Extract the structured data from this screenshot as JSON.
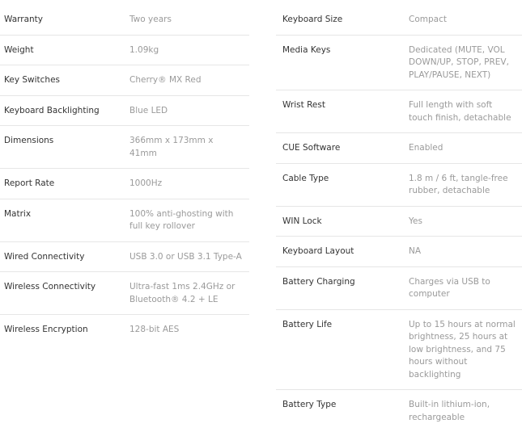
{
  "left_specs": [
    {
      "label": "Warranty",
      "value": "Two years"
    },
    {
      "label": "Weight",
      "value": "1.09kg"
    },
    {
      "label": "Key Switches",
      "value": "Cherry® MX Red"
    },
    {
      "label": "Keyboard Backlighting",
      "value": "Blue LED"
    },
    {
      "label": "Dimensions",
      "value": "366mm x 173mm x 41mm"
    },
    {
      "label": "Report Rate",
      "value": "1000Hz"
    },
    {
      "label": "Matrix",
      "value": "100% anti-ghosting with full key rollover"
    },
    {
      "label": "Wired Connectivity",
      "value": "USB 3.0 or USB 3.1 Type-A"
    },
    {
      "label": "Wireless Connectivity",
      "value": "Ultra-fast 1ms 2.4GHz or Bluetooth® 4.2 + LE"
    },
    {
      "label": "Wireless Encryption",
      "value": "128-bit AES"
    }
  ],
  "right_specs": [
    {
      "label": "Keyboard Size",
      "value": "Compact"
    },
    {
      "label": "Media Keys",
      "value": "Dedicated (MUTE, VOL DOWN/UP, STOP, PREV, PLAY/PAUSE, NEXT)"
    },
    {
      "label": "Wrist Rest",
      "value": "Full length with soft touch finish, detachable"
    },
    {
      "label": "CUE Software",
      "value": "Enabled"
    },
    {
      "label": "Cable Type",
      "value": "1.8 m / 6 ft, tangle-free rubber, detachable"
    },
    {
      "label": "WIN Lock",
      "value": "Yes"
    },
    {
      "label": "Keyboard Layout",
      "value": "NA"
    },
    {
      "label": "Battery Charging",
      "value": "Charges via USB to computer"
    },
    {
      "label": "Battery Life",
      "value": "Up to 15 hours at normal brightness, 25 hours at low brightness, and 75 hours without backlighting"
    },
    {
      "label": "Battery Type",
      "value": "Built-in lithium-ion, rechargeable"
    }
  ]
}
